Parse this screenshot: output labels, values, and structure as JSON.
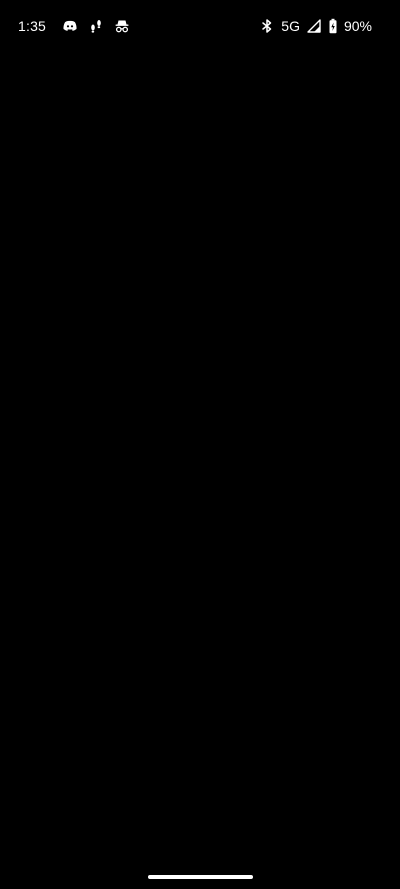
{
  "status_bar": {
    "time": "1:35",
    "notification_icons": [
      "discord-icon",
      "footprints-icon",
      "incognito-icon"
    ],
    "system_icons": [
      "bluetooth-icon",
      "signal-icon",
      "battery-icon"
    ],
    "network_label": "5G",
    "battery_label": "90%"
  },
  "colors": {
    "background": "#000000",
    "foreground": "#ffffff"
  }
}
